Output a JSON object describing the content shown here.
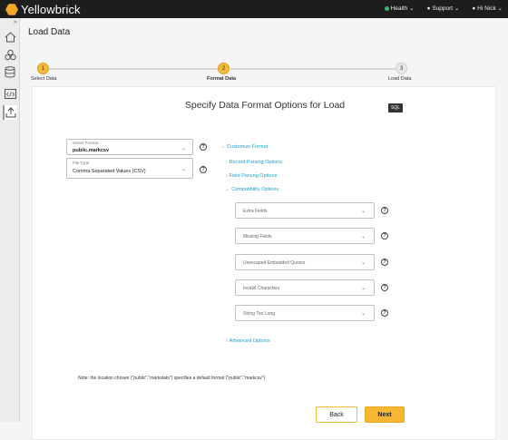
{
  "app": {
    "name": "Yellowbrick"
  },
  "topbar": {
    "health_label": "Health",
    "support_label": "Support",
    "user_label": "Hi Nick",
    "health_color": "#3cb371"
  },
  "sidebar": {
    "items": [
      {
        "icon": "home-icon"
      },
      {
        "icon": "cluster-icon"
      },
      {
        "icon": "database-icon"
      },
      {
        "icon": "code-editor-icon"
      },
      {
        "icon": "upload-icon",
        "active": true
      }
    ]
  },
  "page": {
    "title": "Load Data"
  },
  "stepper": {
    "steps": [
      {
        "number": "1",
        "label": "Select Data",
        "state": "complete"
      },
      {
        "number": "2",
        "label": "Format Data",
        "state": "active"
      },
      {
        "number": "3",
        "label": "Load Data",
        "state": "pending"
      }
    ]
  },
  "card": {
    "title": "Specify Data Format Options for Load",
    "sql_label": "SQL"
  },
  "form": {
    "select_format": {
      "label": "Select Format",
      "value": "public.markcsv"
    },
    "file_type": {
      "label": "File Type",
      "value": "Comma Separated Values (CSV)"
    }
  },
  "options": {
    "customize_format": "Customize Format",
    "record_parsing": "Record Parsing Options",
    "field_parsing": "Field Parsing Options",
    "compatibility": "Compatibility Options",
    "dropdowns": [
      {
        "label": "Extra Fields"
      },
      {
        "label": "Missing Fields"
      },
      {
        "label": "Unescaped Embedded Quotes"
      },
      {
        "label": "Invalid Characters"
      },
      {
        "label": "String Too Long"
      }
    ],
    "advanced": "Advanced Options"
  },
  "note": "Note: the location chosen (\"public\".\"markstats\") specifies a default format (\"public\".\"markcsv\")",
  "buttons": {
    "back": "Back",
    "next": "Next"
  },
  "colors": {
    "accent": "#f7b733",
    "link": "#1a9fc9",
    "topbar": "#1d1d1d"
  }
}
